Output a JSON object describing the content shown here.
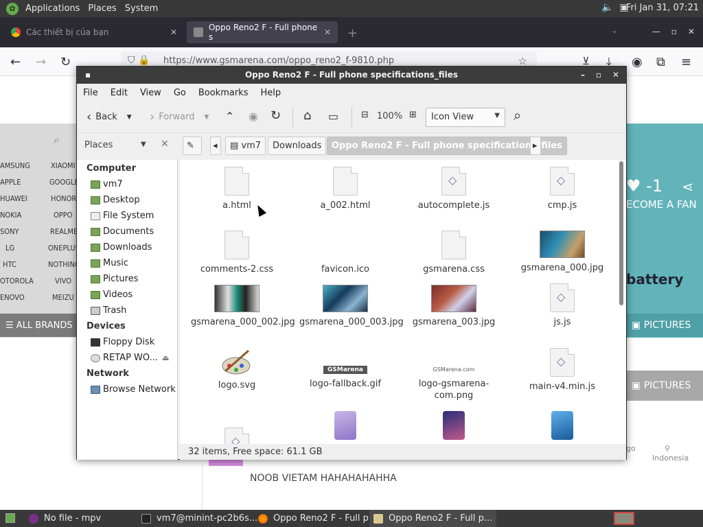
{
  "top_panel": {
    "menus": [
      "Applications",
      "Places",
      "System"
    ],
    "clock": "Fri Jan 31, 07:21"
  },
  "browser": {
    "tabs": [
      {
        "label": "Các thiết bị của bạn",
        "active": false
      },
      {
        "label": "Oppo Reno2 F - Full phone s",
        "active": true
      }
    ],
    "url": "https://www.gsmarena.com/oppo_reno2_f-9810.php"
  },
  "site": {
    "brands": [
      "AMSUNG",
      "XIAOMI",
      "APPLE",
      "GOOGLE",
      "HUAWEI",
      "HONOR",
      "NOKIA",
      "OPPO",
      "SONY",
      "REALME",
      "LG",
      "ONEPLUS",
      "HTC",
      "NOTHING",
      "OTOROLA",
      "VIVO",
      "ENOVO",
      "MEIZU"
    ],
    "all_brands": "ALL BRANDS",
    "likes": "-1",
    "become_fan": "ECOME A FAN",
    "battery": "battery",
    "pictures_label": "PICTURES",
    "comment_avatar": "N",
    "comment_text": "NOOB VIETAM HAHAHAHAHHA",
    "country": "Indonesia",
    "go_partial": "go"
  },
  "file_manager": {
    "title": "Oppo Reno2 F - Full phone specifications_files",
    "menu": [
      "File",
      "Edit",
      "View",
      "Go",
      "Bookmarks",
      "Help"
    ],
    "toolbar": {
      "back": "Back",
      "forward": "Forward",
      "zoom": "100%",
      "view_mode": "Icon View"
    },
    "places_label": "Places",
    "breadcrumbs": [
      "vm7",
      "Downloads",
      "Oppo Reno2 F - Full phone specifications_files"
    ],
    "sidebar": {
      "computer_header": "Computer",
      "computer_items": [
        "vm7",
        "Desktop",
        "File System",
        "Documents",
        "Downloads",
        "Music",
        "Pictures",
        "Videos",
        "Trash"
      ],
      "devices_header": "Devices",
      "devices_items": [
        "Floppy Disk",
        "RETAP WO..."
      ],
      "network_header": "Network",
      "network_items": [
        "Browse Network"
      ]
    },
    "files": [
      {
        "name": "a.html",
        "kind": "doc"
      },
      {
        "name": "a_002.html",
        "kind": "doc"
      },
      {
        "name": "autocomplete.js",
        "kind": "js"
      },
      {
        "name": "cmp.js",
        "kind": "js"
      },
      {
        "name": "comments-2.css",
        "kind": "doc"
      },
      {
        "name": "favicon.ico",
        "kind": "blank"
      },
      {
        "name": "gsmarena.css",
        "kind": "doc"
      },
      {
        "name": "gsmarena_000.jpg",
        "kind": "image"
      },
      {
        "name": "gsmarena_000_002.jpg",
        "kind": "image"
      },
      {
        "name": "gsmarena_000_003.jpg",
        "kind": "image"
      },
      {
        "name": "gsmarena_003.jpg",
        "kind": "image"
      },
      {
        "name": "js.js",
        "kind": "js"
      },
      {
        "name": "logo.svg",
        "kind": "svg"
      },
      {
        "name": "logo-fallback.gif",
        "kind": "image"
      },
      {
        "name": "logo-gsmarena-com.png",
        "kind": "image"
      },
      {
        "name": "main-v4.min.js",
        "kind": "js"
      }
    ],
    "logo_text": "GSMarena",
    "logo_png_text": "GSMarena.com",
    "status": "32 items, Free space: 61.1 GB"
  },
  "taskbar": {
    "items": [
      "No file - mpv",
      "vm7@minint-pc2b6s...",
      "Oppo Reno2 F - Full p...",
      "Oppo Reno2 F - Full p..."
    ]
  }
}
